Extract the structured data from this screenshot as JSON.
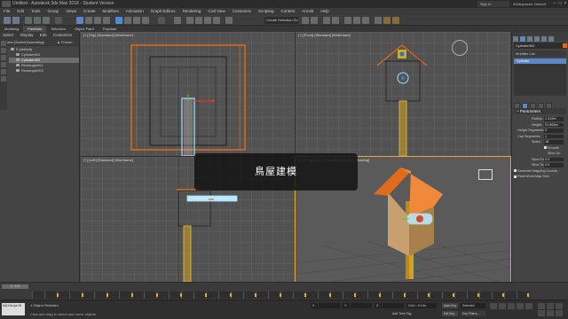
{
  "window": {
    "title": "Untitled - Autodesk 3ds Max 2018 - Student Version",
    "sign_in": "Sign In",
    "workspaces_label": "Workspaces:",
    "workspace_value": "Default"
  },
  "menu": [
    "File",
    "Edit",
    "Tools",
    "Group",
    "Views",
    "Create",
    "Modifiers",
    "Animation",
    "Graph Editors",
    "Rendering",
    "Civil View",
    "Customize",
    "Scripting",
    "Content",
    "Arnold",
    "Help"
  ],
  "toolbar": {
    "selection_set": "Create Selection Se"
  },
  "ribbon": {
    "tabs": [
      "Modeling",
      "Freeform",
      "Selection",
      "Object Paint",
      "Populate"
    ],
    "active": "Freeform"
  },
  "scene_explorer": {
    "menu": [
      "Select",
      "Display",
      "Edit",
      "Customize"
    ],
    "header_name": "Name (Sorted Ascending)",
    "header_frozen": "▲ Frozen",
    "items": [
      {
        "label": "0 (default)",
        "selected": false,
        "indent": 0
      },
      {
        "label": "Cylinder001",
        "selected": false,
        "indent": 1
      },
      {
        "label": "Cylinder002",
        "selected": true,
        "indent": 1
      },
      {
        "label": "Rectangle001",
        "selected": false,
        "indent": 1
      },
      {
        "label": "Rectangle002",
        "selected": false,
        "indent": 1
      }
    ]
  },
  "viewports": {
    "top": "[+] [Top] [Standard] [Wireframe]",
    "front": "[+] [Front] [Standard] [Wireframe]",
    "left": "[+] [Left] [Standard] [Wireframe]",
    "perspective": "[+] [Perspective] [Standard] [Default Shading]"
  },
  "command_panel": {
    "object_name": "Cylinder002",
    "modifier_list": "Modifier List",
    "stack_item": "Cylinder",
    "rollout_title": "Parameters",
    "params": [
      {
        "label": "Radius:",
        "value": "1.419m"
      },
      {
        "label": "Height:",
        "value": "51.868m"
      },
      {
        "label": "Height Segments:",
        "value": "5"
      },
      {
        "label": "Cap Segments:",
        "value": "1"
      },
      {
        "label": "Sides:",
        "value": "18"
      }
    ],
    "checks": [
      {
        "label": "Smooth",
        "indent": true
      },
      {
        "label": "Slice On",
        "indent": true
      },
      {
        "label": "Slice From:",
        "value": "0.0"
      },
      {
        "label": "Slice To:",
        "value": "0.0"
      },
      {
        "label": "Generate Mapping Coords.",
        "indent": false
      },
      {
        "label": "Real-World Map Size",
        "indent": false
      }
    ],
    "accent_color": "#e06b1a",
    "selected_color": "#5b87c6"
  },
  "timeline": {
    "frame": "0 / 100",
    "keys": [
      5,
      10,
      15,
      20,
      25,
      30,
      35,
      40,
      45,
      50,
      55,
      60,
      65,
      70,
      75,
      80,
      85,
      90,
      95,
      100
    ]
  },
  "status": {
    "maxscript": "MAXScript Mi",
    "line1": "1 Object Selected",
    "line2": "Click and drag to select and move objects",
    "x_label": "X:",
    "y_label": "Y:",
    "z_label": "Z:",
    "grid": "Grid = 10.0m",
    "add_time_tag": "Add Time Tag",
    "auto_key": "Auto Key",
    "set_key": "Set Key",
    "selected": "Selected",
    "key_filters": "Key Filters..."
  },
  "subtitle": "鳥屋建模"
}
